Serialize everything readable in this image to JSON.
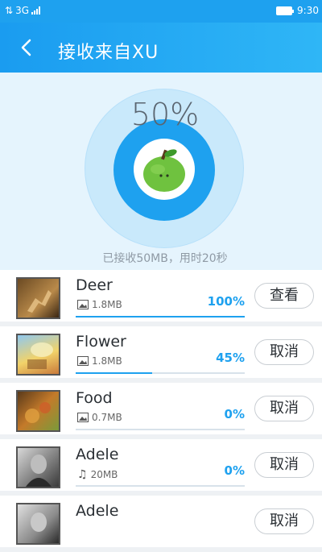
{
  "status": {
    "network": "3G",
    "time": "9:30"
  },
  "header": {
    "title": "接收来自XU"
  },
  "progress": {
    "percent_label": "50%",
    "percent": 0.5,
    "received_label": "已接收50MB，用时20秒"
  },
  "files": [
    {
      "name": "Deer",
      "size": "1.8MB",
      "type_icon": "image-icon",
      "progress": 1.0,
      "progress_label": "100%",
      "action": "查看"
    },
    {
      "name": "Flower",
      "size": "1.8MB",
      "type_icon": "image-icon",
      "progress": 0.45,
      "progress_label": "45%",
      "action": "取消"
    },
    {
      "name": "Food",
      "size": "0.7MB",
      "type_icon": "image-icon",
      "progress": 0.0,
      "progress_label": "0%",
      "action": "取消"
    },
    {
      "name": "Adele",
      "size": "20MB",
      "type_icon": "music-note-icon",
      "progress": 0.0,
      "progress_label": "0%",
      "action": "取消"
    },
    {
      "name": "Adele",
      "size": "",
      "type_icon": "image-icon",
      "progress": 0.0,
      "progress_label": "",
      "action": "取消"
    }
  ],
  "colors": {
    "accent": "#1ea1ef",
    "ring_light": "#c9e9fb",
    "hero_bg": "#e5f4fd"
  }
}
